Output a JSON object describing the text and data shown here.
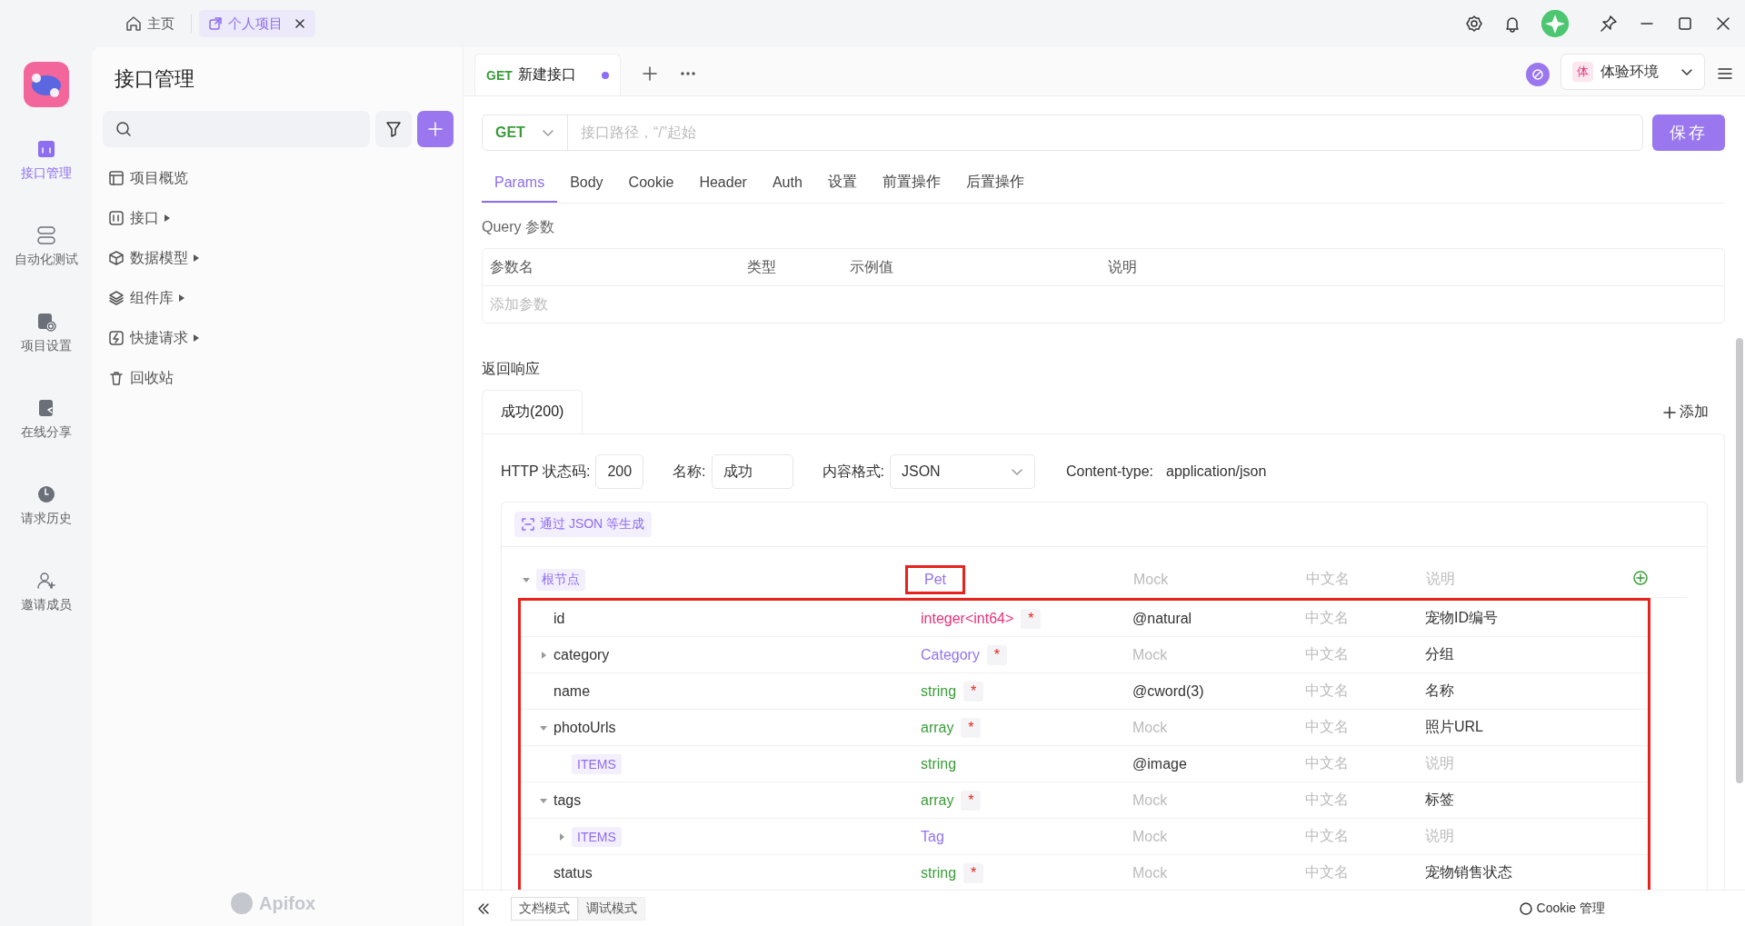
{
  "title_bar": {
    "tabs": [
      {
        "label": "主页",
        "selected": false
      },
      {
        "label": "个人项目",
        "selected": true
      }
    ]
  },
  "rail": {
    "items": [
      {
        "label": "接口管理",
        "selected": true
      },
      {
        "label": "自动化测试",
        "selected": false
      },
      {
        "label": "项目设置",
        "selected": false
      },
      {
        "label": "在线分享",
        "selected": false
      },
      {
        "label": "请求历史",
        "selected": false
      },
      {
        "label": "邀请成员",
        "selected": false
      }
    ]
  },
  "sidebar": {
    "title": "接口管理",
    "items": [
      {
        "label": "项目概览",
        "has_submenu": false
      },
      {
        "label": "接口",
        "has_submenu": true
      },
      {
        "label": "数据模型",
        "has_submenu": true
      },
      {
        "label": "组件库",
        "has_submenu": true
      },
      {
        "label": "快捷请求",
        "has_submenu": true
      },
      {
        "label": "回收站",
        "has_submenu": false
      }
    ],
    "brand": "Apifox"
  },
  "editor_tabs": [
    {
      "method": "GET",
      "label": "新建接口",
      "unsaved": true,
      "selected": true
    }
  ],
  "environment": {
    "badge": "体",
    "label": "体验环境"
  },
  "request": {
    "method": "GET",
    "url_placeholder": "接口路径，“/”起始",
    "save": "保存"
  },
  "request_tabs": [
    {
      "label": "Params",
      "selected": true
    },
    {
      "label": "Body",
      "selected": false
    },
    {
      "label": "Cookie",
      "selected": false
    },
    {
      "label": "Header",
      "selected": false
    },
    {
      "label": "Auth",
      "selected": false
    },
    {
      "label": "设置",
      "selected": false
    },
    {
      "label": "前置操作",
      "selected": false
    },
    {
      "label": "后置操作",
      "selected": false
    }
  ],
  "query": {
    "title": "Query 参数",
    "columns": [
      "参数名",
      "类型",
      "示例值",
      "说明"
    ],
    "add_placeholder": "添加参数"
  },
  "response": {
    "title": "返回响应",
    "tabs": [
      {
        "label": "成功(200)",
        "selected": true
      }
    ],
    "add": "添加",
    "status_label": "HTTP 状态码:",
    "status_code": "200",
    "name_label": "名称:",
    "name": "成功",
    "format_label": "内容格式:",
    "format": "JSON",
    "content_type_label": "Content-type:",
    "content_type": "application/json",
    "generate": "通过 JSON 等生成",
    "schema": {
      "children_highlighted": true,
      "root": {
        "kind": "root",
        "name": "根节点",
        "type": "Pet",
        "color": "#9373ee",
        "expanded": true,
        "highlighted": true,
        "mock": {
          "placeholder": "Mock"
        },
        "title": {
          "placeholder": "中文名"
        },
        "description": {
          "placeholder": "说明"
        },
        "children": [
          {
            "kind": "field",
            "name": "id",
            "type": "integer<int64>",
            "color": "#e6337a",
            "required_mark": "*",
            "mock": {
              "value": "@natural"
            },
            "title": {
              "placeholder": "中文名"
            },
            "description": {
              "value": "宠物ID编号"
            }
          },
          {
            "kind": "field",
            "name": "category",
            "type": "Category",
            "color": "#9373ee",
            "required_mark": "*",
            "expanded": false,
            "mock": {
              "placeholder": "Mock"
            },
            "title": {
              "placeholder": "中文名"
            },
            "description": {
              "value": "分组"
            }
          },
          {
            "kind": "field",
            "name": "name",
            "type": "string",
            "color": "#3a9c3a",
            "required_mark": "*",
            "mock": {
              "value": "@cword(3)"
            },
            "title": {
              "placeholder": "中文名"
            },
            "description": {
              "value": "名称"
            }
          },
          {
            "kind": "field",
            "name": "photoUrls",
            "type": "array",
            "color": "#3a9c3a",
            "required_mark": "*",
            "expanded": true,
            "mock": {
              "placeholder": "Mock"
            },
            "title": {
              "placeholder": "中文名"
            },
            "description": {
              "value": "照片URL"
            },
            "children": [
              {
                "kind": "items",
                "name": "ITEMS",
                "type": "string",
                "color": "#3a9c3a",
                "mock": {
                  "value": "@image"
                },
                "title": {
                  "placeholder": "中文名"
                },
                "description": {
                  "placeholder": "说明"
                }
              }
            ]
          },
          {
            "kind": "field",
            "name": "tags",
            "type": "array",
            "color": "#3a9c3a",
            "required_mark": "*",
            "expanded": true,
            "mock": {
              "placeholder": "Mock"
            },
            "title": {
              "placeholder": "中文名"
            },
            "description": {
              "value": "标签"
            },
            "children": [
              {
                "kind": "items",
                "name": "ITEMS",
                "type": "Tag",
                "color": "#9373ee",
                "expanded": false,
                "mock": {
                  "placeholder": "Mock"
                },
                "title": {
                  "placeholder": "中文名"
                },
                "description": {
                  "placeholder": "说明"
                }
              }
            ]
          },
          {
            "kind": "field",
            "name": "status",
            "type": "string",
            "color": "#3a9c3a",
            "required_mark": "*",
            "mock": {
              "placeholder": "Mock"
            },
            "title": {
              "placeholder": "中文名"
            },
            "description": {
              "value": "宠物销售状态"
            }
          }
        ]
      }
    }
  },
  "bottom_bar": {
    "modes": [
      {
        "label": "文档模式",
        "selected": true
      },
      {
        "label": "调试模式",
        "selected": false
      }
    ],
    "cookie": "Cookie 管理"
  }
}
